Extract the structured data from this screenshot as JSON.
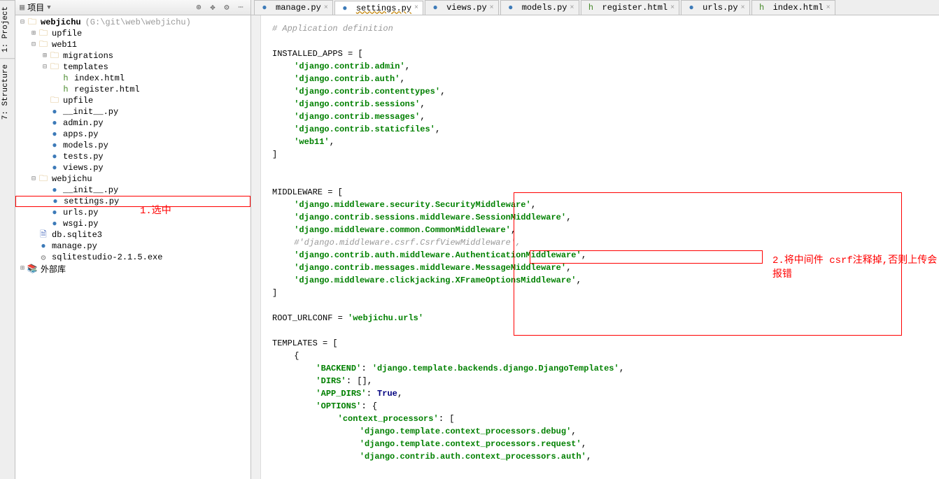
{
  "sidebar_tabs": [
    "1: Project",
    "7: Structure"
  ],
  "project_panel": {
    "title": "项目"
  },
  "tree": {
    "root": {
      "label": "webjichu",
      "hint": "(G:\\git\\web\\webjichu)"
    },
    "upfile": "upfile",
    "web11": "web11",
    "migrations": "migrations",
    "templates": "templates",
    "index_html": "index.html",
    "register_html": "register.html",
    "upfile2": "upfile",
    "init_py": "__init__.py",
    "admin_py": "admin.py",
    "apps_py": "apps.py",
    "models_py": "models.py",
    "tests_py": "tests.py",
    "views_py": "views.py",
    "webjichu2": "webjichu",
    "init2_py": "__init__.py",
    "settings_py": "settings.py",
    "urls_py": "urls.py",
    "wsgi_py": "wsgi.py",
    "db_sqlite": "db.sqlite3",
    "manage_py": "manage.py",
    "sqlitestudio": "sqlitestudio-2.1.5.exe",
    "ext_lib": "外部库"
  },
  "annotation1": "1.选中",
  "annotation2": "2.将中间件 csrf注释掉,否则上传会报错",
  "tabs": [
    {
      "name": "manage.py",
      "type": "py"
    },
    {
      "name": "settings.py",
      "type": "py",
      "active": true
    },
    {
      "name": "views.py",
      "type": "py"
    },
    {
      "name": "models.py",
      "type": "py"
    },
    {
      "name": "register.html",
      "type": "html"
    },
    {
      "name": "urls.py",
      "type": "py"
    },
    {
      "name": "index.html",
      "type": "html"
    }
  ],
  "code": {
    "c0": "# Application definition",
    "c1": "INSTALLED_APPS = [",
    "c2": "'django.contrib.admin'",
    "c3": "'django.contrib.auth'",
    "c4": "'django.contrib.contenttypes'",
    "c5": "'django.contrib.sessions'",
    "c6": "'django.contrib.messages'",
    "c7": "'django.contrib.staticfiles'",
    "c8": "'web11'",
    "c9": "]",
    "c10": "MIDDLEWARE = [",
    "c11": "'django.middleware.security.SecurityMiddleware'",
    "c12": "'django.contrib.sessions.middleware.SessionMiddleware'",
    "c13": "'django.middleware.common.CommonMiddleware'",
    "c14": "#'django.middleware.csrf.CsrfViewMiddleware',",
    "c15": "'django.contrib.auth.middleware.AuthenticationMiddleware'",
    "c16": "'django.contrib.messages.middleware.MessageMiddleware'",
    "c17": "'django.middleware.clickjacking.XFrameOptionsMiddleware'",
    "c18": "]",
    "c19": "ROOT_URLCONF = ",
    "c19s": "'webjichu.urls'",
    "c20": "TEMPLATES = [",
    "c21": "{",
    "c22k": "'BACKEND'",
    "c22v": "'django.template.backends.django.DjangoTemplates'",
    "c23k": "'DIRS'",
    "c23v": "[]",
    "c24k": "'APP_DIRS'",
    "c24v": "True",
    "c25k": "'OPTIONS'",
    "c25v": "{",
    "c26k": "'context_processors'",
    "c26v": "[",
    "c27": "'django.template.context_processors.debug'",
    "c28": "'django.template.context_processors.request'",
    "c29": "'django.contrib.auth.context_processors.auth'"
  }
}
